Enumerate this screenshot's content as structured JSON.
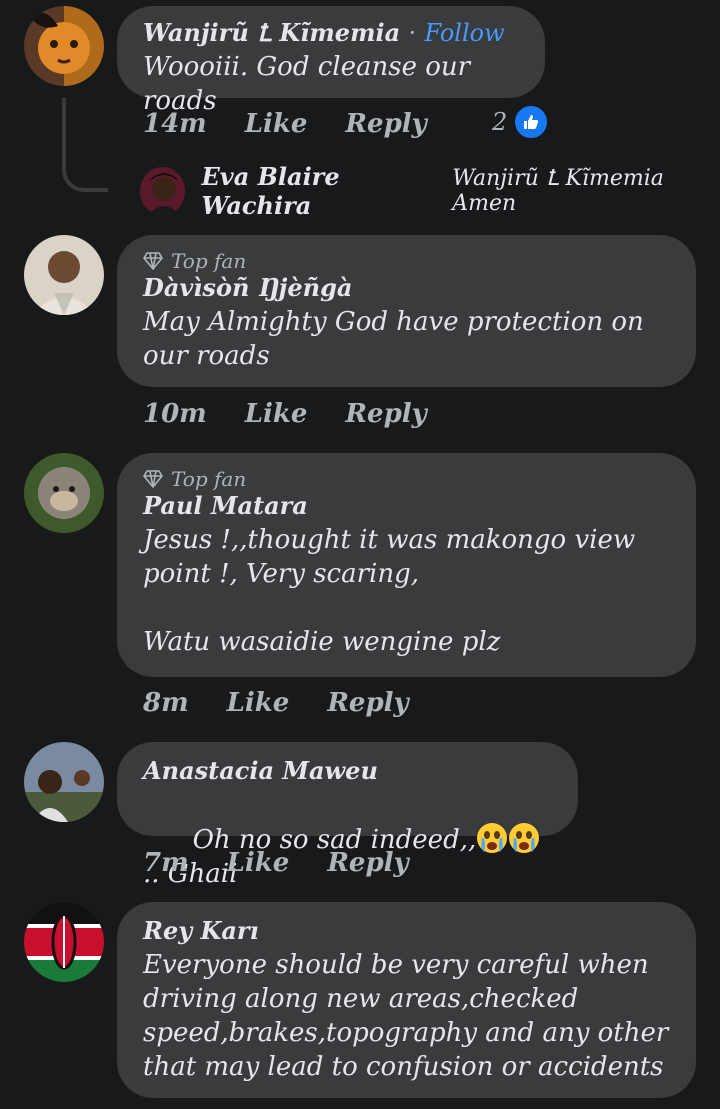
{
  "comments": [
    {
      "name": "Wanjirũ Ꝉ Kĩmemia",
      "follow": "Follow",
      "text": "Woooiii. God cleanse our roads",
      "time": "14m",
      "like": "Like",
      "reply": "Reply",
      "reaction_count": "2",
      "avatar_icon": "lion-face-avatar"
    },
    {
      "badge": "Top fan",
      "name": "Dàvìsòñ Ŋjèñgà",
      "text": "May Almighty God have protection on our roads",
      "time": "10m",
      "like": "Like",
      "reply": "Reply",
      "avatar_icon": "man-portrait-avatar"
    },
    {
      "badge": "Top fan",
      "name": "Paul Matara",
      "text": "Jesus !,,thought it was makongo view point !, Very scaring,\n\nWatu wasaidie wengine plz",
      "time": "8m",
      "like": "Like",
      "reply": "Reply",
      "avatar_icon": "monkey-avatar"
    },
    {
      "name": "Anastacia Maweu",
      "text": "Oh no so sad indeed,,",
      "text_suffix": ".. Ghaii",
      "emoji": "crying-face",
      "time": "7m",
      "like": "Like",
      "reply": "Reply",
      "avatar_icon": "group-photo-avatar"
    },
    {
      "name": "Rey Karı",
      "text": "Everyone should be very careful when driving along new areas,checked speed,brakes,topography and any other that may lead to confusion or accidents",
      "avatar_icon": "kenya-flag-avatar"
    }
  ],
  "reply": {
    "name": "Eva Blaire Wachira",
    "mention": "Wanjirũ Ꝉ Kĩmemia",
    "text": "Amen",
    "avatar_icon": "girl-portrait-avatar"
  },
  "colors": {
    "background": "#18191a",
    "bubble": "#3a3b3c",
    "link": "#4599ff",
    "like_badge": "#1877f2"
  }
}
